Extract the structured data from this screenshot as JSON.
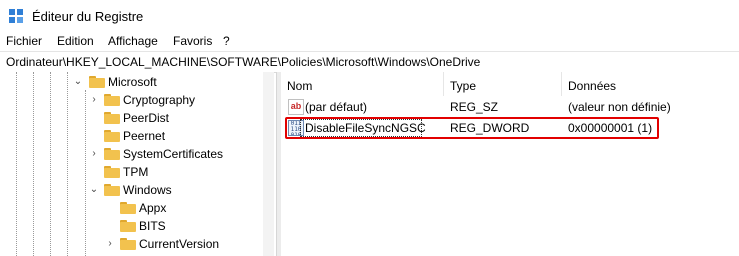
{
  "window": {
    "title": "Éditeur du Registre",
    "app_icon": "registry-editor-icon"
  },
  "menu": {
    "items": [
      "Fichier",
      "Edition",
      "Affichage",
      "Favoris",
      "?"
    ]
  },
  "address": {
    "path": "Ordinateur\\HKEY_LOCAL_MACHINE\\SOFTWARE\\Policies\\Microsoft\\Windows\\OneDrive"
  },
  "tree": {
    "items": [
      {
        "label": "Microsoft",
        "state": "expanded"
      },
      {
        "label": "Cryptography",
        "state": "collapsed"
      },
      {
        "label": "PeerDist",
        "state": "leaf"
      },
      {
        "label": "Peernet",
        "state": "leaf"
      },
      {
        "label": "SystemCertificates",
        "state": "collapsed"
      },
      {
        "label": "TPM",
        "state": "leaf"
      },
      {
        "label": "Windows",
        "state": "expanded"
      },
      {
        "label": "Appx",
        "state": "leaf"
      },
      {
        "label": "BITS",
        "state": "leaf"
      },
      {
        "label": "CurrentVersion",
        "state": "collapsed"
      }
    ]
  },
  "list": {
    "columns": [
      "Nom",
      "Type",
      "Données"
    ],
    "rows": [
      {
        "icon": "string-value-icon",
        "name": "(par défaut)",
        "type": "REG_SZ",
        "data": "(valeur non définie)"
      },
      {
        "icon": "binary-value-icon",
        "name": "DisableFileSyncNGSC",
        "type": "REG_DWORD",
        "data": "0x00000001 (1)"
      }
    ],
    "highlight_color": "#e20000"
  }
}
